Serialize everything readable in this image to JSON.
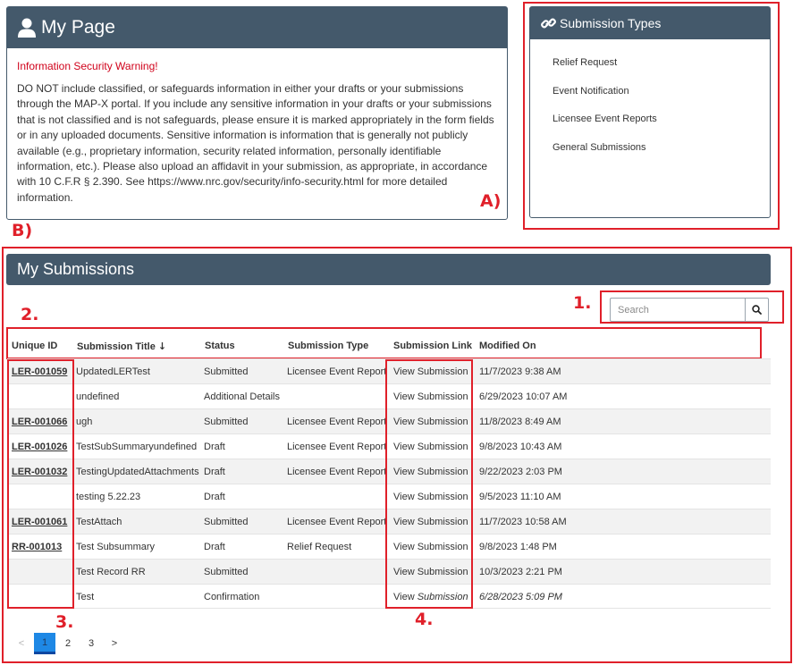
{
  "my_page": {
    "title": "My Page",
    "warning_title": "Information Security Warning!",
    "warning_body": "DO NOT include classified, or safeguards information in either your drafts or your submissions through the MAP-X portal. If you include any sensitive information in your drafts or your submissions that is not classified and is not safeguards, please ensure it is marked appropriately in the form fields or in any uploaded documents. Sensitive information is information that is generally not publicly available (e.g., proprietary information, security related information, personally identifiable information, etc.). Please also upload an affidavit in your submission, as appropriate, in accordance with 10 C.F.R § 2.390. See https://www.nrc.gov/security/info-security.html for more detailed information."
  },
  "submission_types": {
    "title": "Submission Types",
    "items": [
      "Relief Request",
      "Event Notification",
      "Licensee Event Reports",
      "General Submissions"
    ]
  },
  "annotations": {
    "a": "A)",
    "b": "B)",
    "n1": "1.",
    "n2": "2.",
    "n3": "3.",
    "n4": "4."
  },
  "my_submissions": {
    "title": "My Submissions",
    "search_placeholder": "Search",
    "columns": {
      "unique_id": "Unique ID",
      "submission_title": "Submission Title",
      "status": "Status",
      "submission_type": "Submission Type",
      "submission_link": "Submission Link",
      "modified_on": "Modified On"
    },
    "sort_indicator": "↓",
    "rows": [
      {
        "id": "LER-001059",
        "title": "UpdatedLERTest",
        "status": "Submitted",
        "type": "Licensee Event Report",
        "link": "View Submission",
        "modified": "11/7/2023 9:38 AM"
      },
      {
        "id": "",
        "title": "undefined",
        "status": "Additional Details",
        "type": "",
        "link": "View Submission",
        "modified": "6/29/2023 10:07 AM"
      },
      {
        "id": "LER-001066",
        "title": "ugh",
        "status": "Submitted",
        "type": "Licensee Event Report",
        "link": "View Submission",
        "modified": "11/8/2023 8:49 AM"
      },
      {
        "id": "LER-001026",
        "title": "TestSubSummaryundefined",
        "status": "Draft",
        "type": "Licensee Event Report",
        "link": "View Submission",
        "modified": "9/8/2023 10:43 AM"
      },
      {
        "id": "LER-001032",
        "title": "TestingUpdatedAttachments",
        "status": "Draft",
        "type": "Licensee Event Report",
        "link": "View Submission",
        "modified": "9/22/2023 2:03 PM"
      },
      {
        "id": "",
        "title": "testing 5.22.23",
        "status": "Draft",
        "type": "",
        "link": "View Submission",
        "modified": "9/5/2023 11:10 AM"
      },
      {
        "id": "LER-001061",
        "title": "TestAttach",
        "status": "Submitted",
        "type": "Licensee Event Report",
        "link": "View Submission",
        "modified": "11/7/2023 10:58 AM"
      },
      {
        "id": "RR-001013",
        "title": "Test Subsummary",
        "status": "Draft",
        "type": "Relief Request",
        "link": "View Submission",
        "modified": "9/8/2023 1:48 PM"
      },
      {
        "id": "",
        "title": "Test Record RR",
        "status": "Submitted",
        "type": "",
        "link": "View Submission",
        "modified": "10/3/2023 2:21 PM"
      },
      {
        "id": "",
        "title": "Test",
        "status": "Confirmation",
        "type": "",
        "link_a": "View ",
        "link_b": "Submission",
        "modified": "6/28/2023 5:09 PM"
      }
    ],
    "pager": {
      "prev": "<",
      "pages": [
        "1",
        "2",
        "3"
      ],
      "next": ">",
      "current": "1"
    }
  },
  "colors": {
    "header": "#44596b",
    "annotation": "#e0202a",
    "warning": "#d0021b",
    "active_page": "#1e88e5"
  }
}
